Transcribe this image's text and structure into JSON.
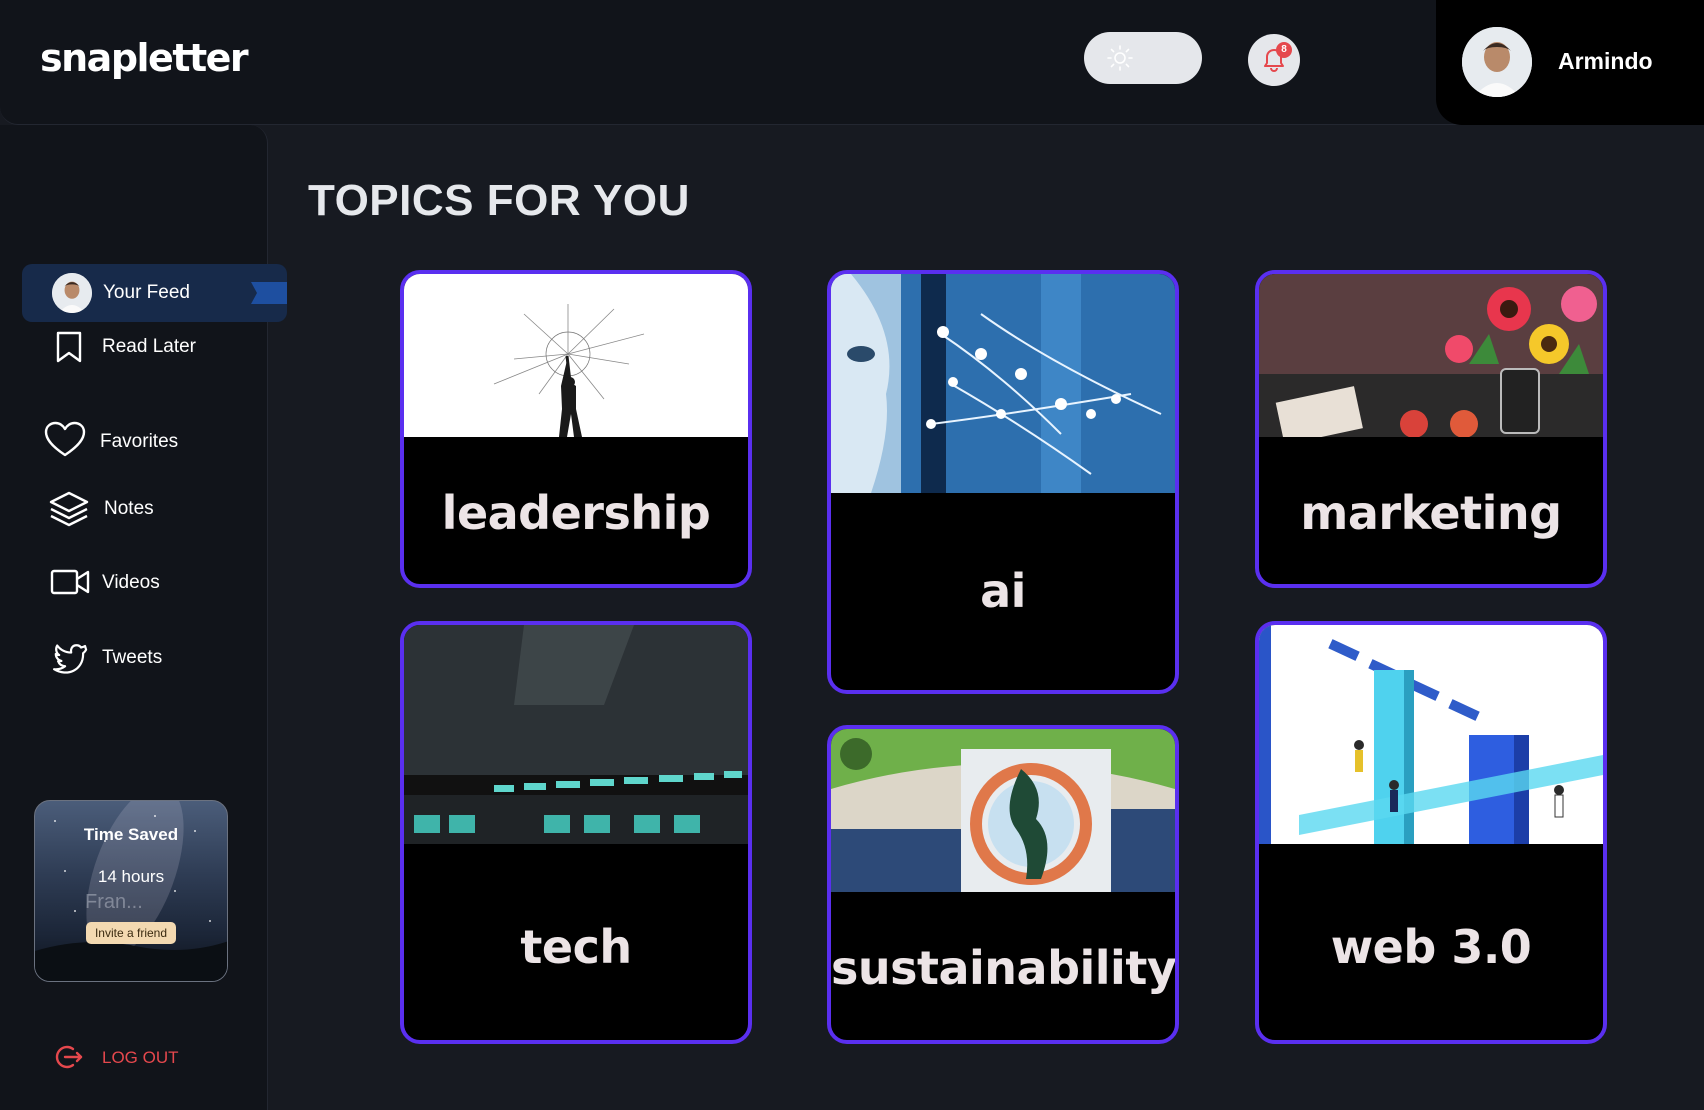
{
  "header": {
    "logo": "snapletter",
    "notification_count": "8",
    "user_name": "Armindo"
  },
  "sidebar": {
    "items": [
      {
        "label": "Your Feed",
        "icon": "avatar",
        "active": true
      },
      {
        "label": "Read Later",
        "icon": "bookmark-icon"
      },
      {
        "label": "Favorites",
        "icon": "heart-icon"
      },
      {
        "label": "Notes",
        "icon": "layers-icon"
      },
      {
        "label": "Videos",
        "icon": "video-camera-icon"
      },
      {
        "label": "Tweets",
        "icon": "twitter-bird-icon"
      }
    ],
    "time_saved": {
      "title": "Time Saved",
      "value": "14 hours",
      "ghost_text": "Fran...",
      "invite_label": "Invite a friend"
    },
    "logout_label": "LOG OUT"
  },
  "main": {
    "heading": "TOPICS FOR YOU",
    "topics": [
      {
        "label": "leadership"
      },
      {
        "label": "ai"
      },
      {
        "label": "marketing"
      },
      {
        "label": "tech"
      },
      {
        "label": "sustainability"
      },
      {
        "label": "web 3.0"
      }
    ]
  },
  "colors": {
    "background": "#171a21",
    "panel": "#11141a",
    "accent_border": "#5a2ff0",
    "active_nav": "#172a4a",
    "logout": "#e5484d"
  }
}
